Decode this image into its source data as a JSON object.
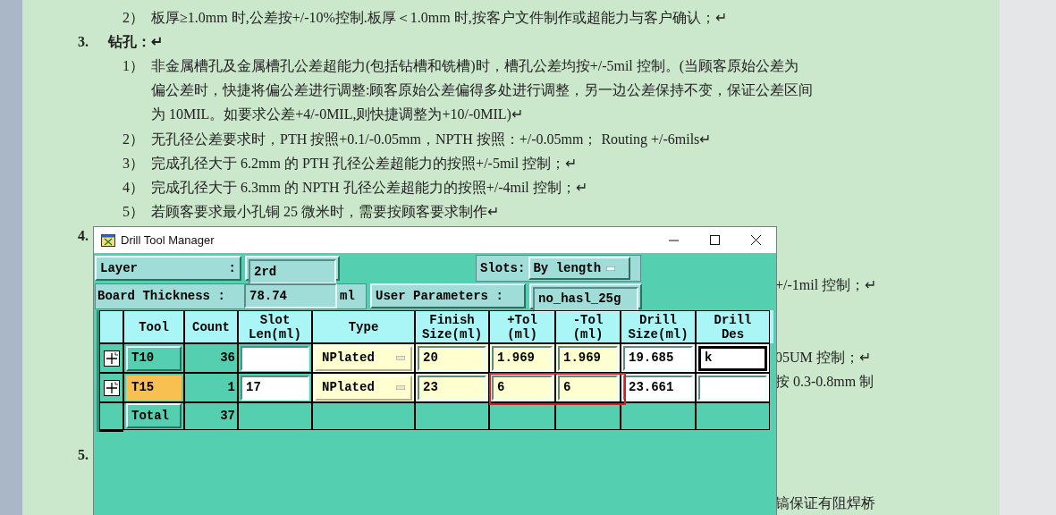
{
  "document": {
    "lines": [
      {
        "kind": "item",
        "number": "2）",
        "text": "板厚≥1.0mm 时,公差按+/-10%控制.板厚＜1.0mm 时,按客户文件制作或超能力与客户确认；↵"
      },
      {
        "kind": "heading",
        "number": "3.",
        "text": "钻孔：↵"
      },
      {
        "kind": "item",
        "number": "1）",
        "text": "非金属槽孔及金属槽孔公差超能力(包括钻槽和铣槽)时，槽孔公差均按+/-5mil 控制。(当顾客原始公差为"
      },
      {
        "kind": "continuation",
        "text": "偏公差时，快捷将偏公差进行调整:顾客原始公差偏得多处进行调整，另一边公差保持不变，保证公差区间"
      },
      {
        "kind": "continuation",
        "text": "为 10MIL。如要求公差+4/-0MIL,则快捷调整为+10/-0MIL)↵"
      },
      {
        "kind": "item",
        "number": "2）",
        "text": "无孔径公差要求时，PTH 按照+0.1/-0.05mm，NPTH 按照：+/-0.05mm； Routing +/-6mils↵"
      },
      {
        "kind": "item",
        "number": "3）",
        "text": "完成孔径大于 6.2mm 的 PTH 孔径公差超能力的按照+/-5mil 控制；↵"
      },
      {
        "kind": "item",
        "number": "4）",
        "text": "完成孔径大于 6.3mm 的 NPTH 孔径公差超能力的按照+/-4mil 控制；↵"
      },
      {
        "kind": "item",
        "number": "5）",
        "text": "若顾客要求最小孔铜 25 微米时，需要按顾客要求制作↵"
      },
      {
        "kind": "heading",
        "number": "4."
      },
      {
        "kind": "blank"
      },
      {
        "kind": "fragment",
        "text": "+/-1mil 控制；↵"
      },
      {
        "kind": "blank"
      },
      {
        "kind": "blank"
      },
      {
        "kind": "fragment",
        "text": "05UM 控制；↵"
      },
      {
        "kind": "fragment",
        "text": "按 0.3-0.8mm 制"
      },
      {
        "kind": "blank"
      },
      {
        "kind": "blank"
      },
      {
        "kind": "heading",
        "number": "5."
      },
      {
        "kind": "blank"
      },
      {
        "kind": "fragment",
        "text": "镐保证有阻焊桥"
      }
    ]
  },
  "window": {
    "title": "Drill Tool Manager",
    "layer": {
      "label": "Layer",
      "colon": ":",
      "value": "2rd"
    },
    "slots": {
      "label": "Slots:",
      "value": "By length"
    },
    "board_thickness": {
      "label": "Board Thickness :",
      "value": "78.74",
      "unit": "ml"
    },
    "user_parameters": {
      "label": "User Parameters :",
      "value": "no_hasl_25g"
    },
    "table": {
      "columns": [
        "Tool",
        "Count",
        "Slot Len(ml)",
        "Type",
        "Finish Size(ml)",
        "+Tol (ml)",
        "-Tol (ml)",
        "Drill Size(ml)",
        "Drill Des"
      ],
      "rows": [
        {
          "tool": "T10",
          "selected": false,
          "count": "36",
          "type": "NPlated",
          "finish": "20",
          "plus_tol": "1.969",
          "minus_tol": "1.969",
          "drill_size": "19.685",
          "drill_des": "k"
        },
        {
          "tool": "T15",
          "selected": true,
          "count": "1",
          "slot_len": "17",
          "type": "NPlated",
          "finish": "23",
          "plus_tol": "6",
          "minus_tol": "6",
          "drill_size": "23.661",
          "tol_highlighted": true
        }
      ],
      "total": {
        "label": "Total",
        "count": "37"
      }
    }
  }
}
